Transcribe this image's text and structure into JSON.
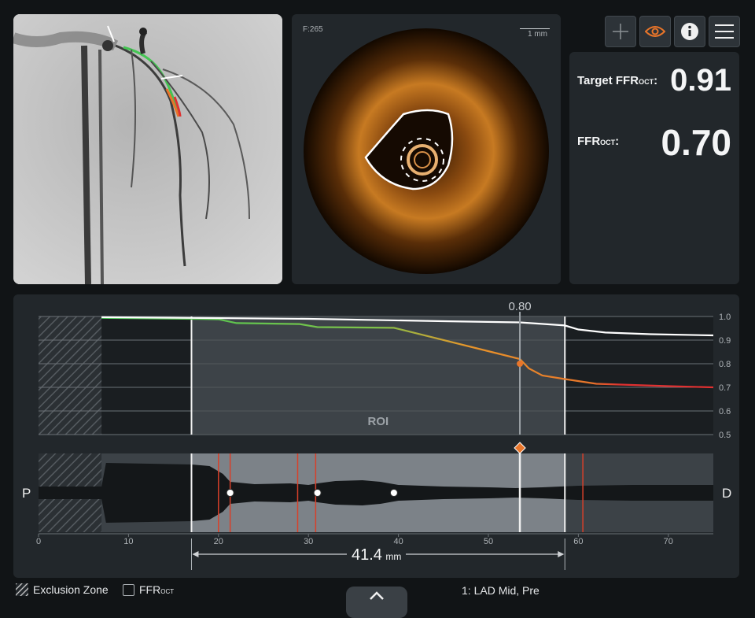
{
  "angiography": {
    "image": "coronary-angiogram"
  },
  "oct": {
    "frame": "F:265",
    "scale": "1 mm"
  },
  "toolbar": {
    "add": "add-icon",
    "eye": "eye-icon",
    "info": "info-icon",
    "menu": "menu-icon"
  },
  "stats": {
    "target_label_main": "Target FFR",
    "target_label_sub": "OCT",
    "target_label_suffix": ":",
    "target_value": "0.91",
    "ffr_label_main": "FFR",
    "ffr_label_sub": "OCT",
    "ffr_label_suffix": ":",
    "ffr_value": "0.70"
  },
  "chart_data": {
    "type": "line",
    "cursor_value": "0.80",
    "roi_label": "ROI",
    "y_ticks": [
      "1.0",
      "0.9",
      "0.8",
      "0.7",
      "0.6",
      "0.5"
    ],
    "ylim": [
      0.5,
      1.0
    ],
    "x_ticks": [
      "0",
      "10",
      "20",
      "30",
      "40",
      "50",
      "60",
      "70"
    ],
    "xlim": [
      0,
      75
    ],
    "roi_mm": [
      17,
      58.5
    ],
    "cursor_mm": 53.5,
    "series": [
      {
        "x": [
          7,
          17,
          20,
          22,
          29,
          31,
          39.5,
          41,
          53.5,
          54.5,
          56,
          58.5,
          62,
          70,
          75
        ],
        "y": [
          0.994,
          0.99,
          0.988,
          0.972,
          0.968,
          0.955,
          0.952,
          0.938,
          0.82,
          0.78,
          0.75,
          0.735,
          0.715,
          0.705,
          0.7
        ],
        "color": "gradient"
      },
      {
        "x": [
          7,
          17,
          30,
          45,
          53.5,
          58.5,
          60,
          63,
          68,
          75
        ],
        "y": [
          0.997,
          0.994,
          0.99,
          0.98,
          0.975,
          0.962,
          0.945,
          0.932,
          0.925,
          0.92
        ],
        "color": "#ffffff"
      }
    ],
    "exclusion_mm": [
      0,
      7
    ]
  },
  "lumen": {
    "p_label": "P",
    "d_label": "D",
    "measurement_value": "41.4",
    "measurement_unit": "mm",
    "red_lines_mm": [
      20,
      21.3,
      28.8,
      30.8,
      60.5
    ],
    "markers_mm": [
      21.3,
      31,
      39.5
    ]
  },
  "footer": {
    "exclusion_label": "Exclusion Zone",
    "ffr_check_main": "FFR",
    "ffr_check_sub": "OCT",
    "pullback_label": "1:  LAD Mid, Pre"
  },
  "colors": {
    "accent": "#e8752a",
    "green": "#44c553",
    "red": "#e03030"
  }
}
